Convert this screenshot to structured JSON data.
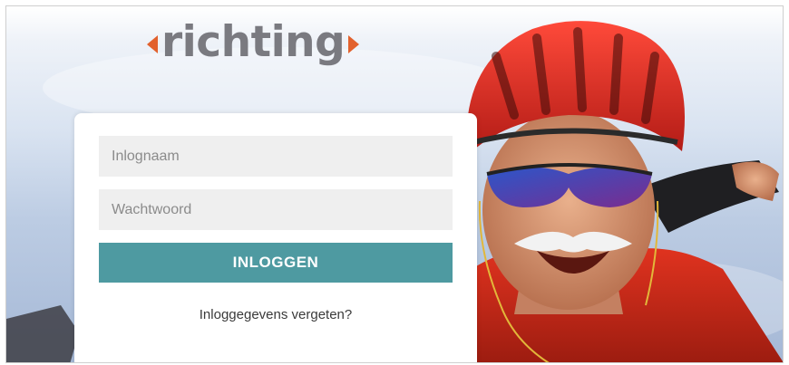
{
  "logo": {
    "text": "richting",
    "accent_color": "#e2612d",
    "text_color": "#7a7a80"
  },
  "login_form": {
    "username_placeholder": "Inlognaam",
    "password_placeholder": "Wachtwoord",
    "submit_label": "INLOGGEN",
    "forgot_link": "Inloggegevens vergeten?",
    "button_color": "#4e9aa1"
  },
  "background": {
    "subject": "cyclist-with-red-helmet-photo"
  }
}
